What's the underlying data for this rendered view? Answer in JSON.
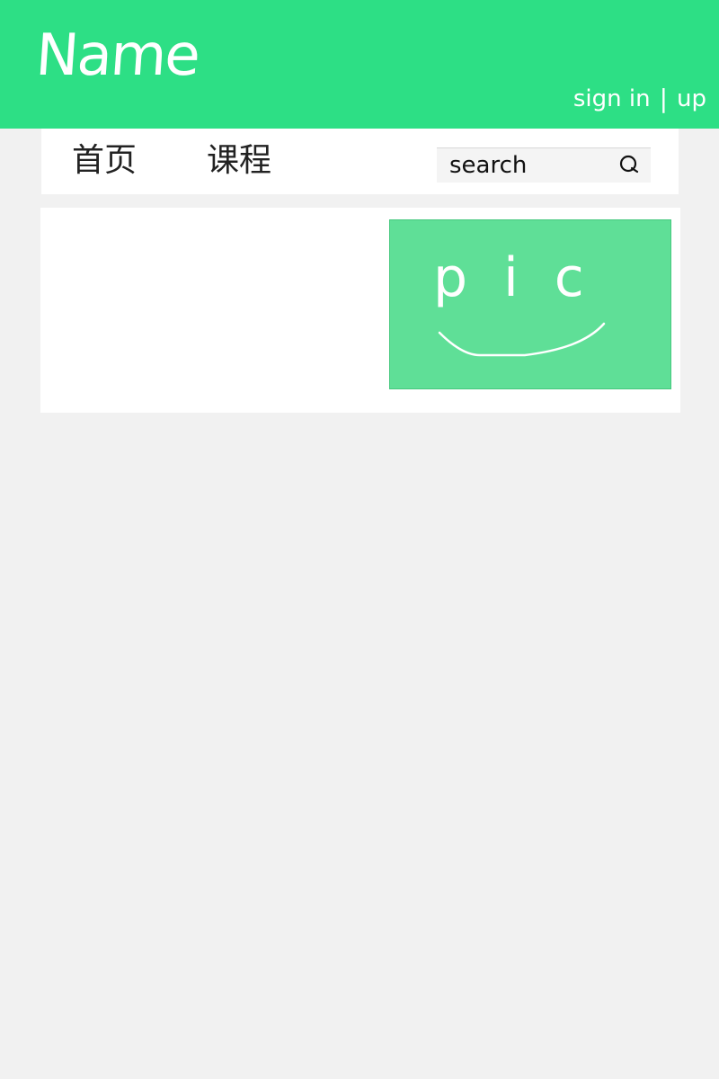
{
  "header": {
    "logo": "Name",
    "sign_in": "sign in",
    "separator": "|",
    "sign_up": "up"
  },
  "nav": {
    "home": "首页",
    "courses": "课程"
  },
  "search": {
    "placeholder": "search",
    "icon": "search-icon"
  },
  "content": {
    "picture_label": "pic"
  },
  "colors": {
    "brand_green": "#2ddf85",
    "pic_green": "#5fdf97",
    "page_background": "#f1f1f1"
  }
}
